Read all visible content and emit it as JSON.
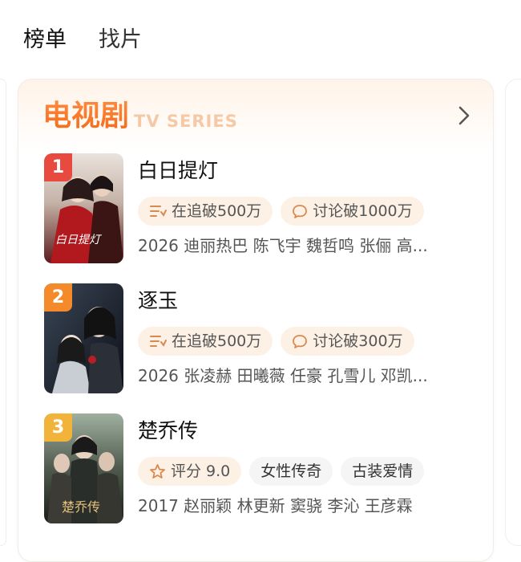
{
  "tabs": [
    {
      "label": "榜单",
      "active": true
    },
    {
      "label": "找片",
      "active": false
    }
  ],
  "card": {
    "title": "电视剧",
    "subtitle": "TV SERIES",
    "arrow_icon": "chevron-right-icon"
  },
  "items": [
    {
      "rank": "1",
      "rank_color": "#e84a3f",
      "title": "白日提灯",
      "tags": [
        {
          "icon": "watchlist-icon",
          "text": "在追破500万"
        },
        {
          "icon": "comment-icon",
          "text": "讨论破1000万"
        }
      ],
      "meta": "2026 迪丽热巴 陈飞宇 魏哲鸣 张俪 高..."
    },
    {
      "rank": "2",
      "rank_color": "#f58a2a",
      "title": "逐玉",
      "tags": [
        {
          "icon": "watchlist-icon",
          "text": "在追破500万"
        },
        {
          "icon": "comment-icon",
          "text": "讨论破300万"
        }
      ],
      "meta": "2026 张凌赫 田曦薇 任豪 孔雪儿 邓凯..."
    },
    {
      "rank": "3",
      "rank_color": "#f2b33a",
      "title": "楚乔传",
      "tags": [
        {
          "icon": "star-icon",
          "text": "评分 9.0"
        },
        {
          "icon": "",
          "text": "女性传奇"
        },
        {
          "icon": "",
          "text": "古装爱情"
        }
      ],
      "meta": "2017 赵丽颖 林更新 窦骁 李沁 王彦霖"
    }
  ]
}
